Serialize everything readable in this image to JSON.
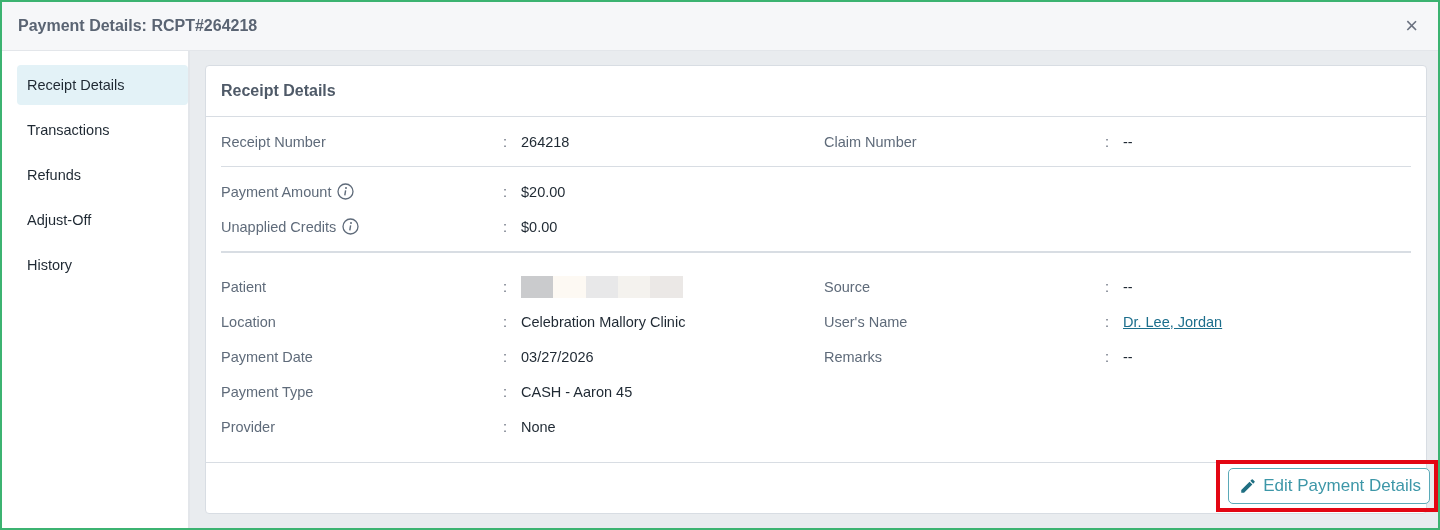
{
  "window": {
    "title": "Payment Details: RCPT#264218",
    "close": "×"
  },
  "sidebar": {
    "items": [
      {
        "label": "Receipt Details",
        "selected": true
      },
      {
        "label": "Transactions",
        "selected": false
      },
      {
        "label": "Refunds",
        "selected": false
      },
      {
        "label": "Adjust-Off",
        "selected": false
      },
      {
        "label": "History",
        "selected": false
      }
    ]
  },
  "card": {
    "title": "Receipt Details",
    "sections": [
      {
        "rows": [
          {
            "left": {
              "label": "Receipt Number",
              "info": false,
              "sep": ":",
              "kind": "text",
              "value": "264218"
            },
            "right": {
              "label": "Claim Number",
              "info": false,
              "sep": ":",
              "kind": "text",
              "value": "--"
            }
          }
        ]
      },
      {
        "rows": [
          {
            "left": {
              "label": "Payment Amount",
              "info": true,
              "sep": ":",
              "kind": "text",
              "value": "$20.00"
            }
          },
          {
            "left": {
              "label": "Unapplied Credits",
              "info": true,
              "sep": ":",
              "kind": "text",
              "value": "$0.00"
            }
          }
        ]
      },
      {
        "rows": [
          {
            "left": {
              "label": "Patient",
              "info": false,
              "sep": ":",
              "kind": "redacted"
            },
            "right": {
              "label": "Source",
              "info": false,
              "sep": ":",
              "kind": "text",
              "value": "--"
            }
          },
          {
            "left": {
              "label": "Location",
              "info": false,
              "sep": ":",
              "kind": "text",
              "value": "Celebration Mallory Clinic"
            },
            "right": {
              "label": "User's Name",
              "info": false,
              "sep": ":",
              "kind": "link",
              "value": "Dr. Lee, Jordan"
            }
          },
          {
            "left": {
              "label": "Payment Date",
              "info": false,
              "sep": ":",
              "kind": "text",
              "value": "03/27/2026"
            },
            "right": {
              "label": "Remarks",
              "info": false,
              "sep": ":",
              "kind": "text",
              "value": "--"
            }
          },
          {
            "left": {
              "label": "Payment Type",
              "info": false,
              "sep": ":",
              "kind": "text",
              "value": "CASH - Aaron 45"
            }
          },
          {
            "left": {
              "label": "Provider",
              "info": false,
              "sep": ":",
              "kind": "text",
              "value": "None"
            }
          }
        ]
      }
    ],
    "action": {
      "label": "Edit Payment Details",
      "highlighted": true
    }
  }
}
